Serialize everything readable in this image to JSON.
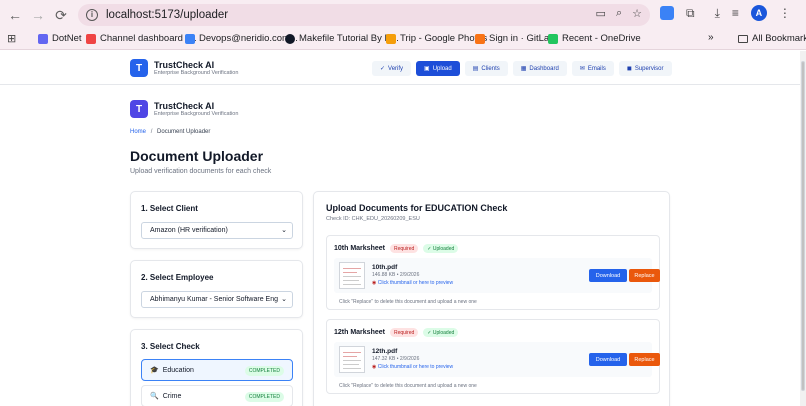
{
  "browser": {
    "url": "localhost:5173/uploader",
    "bookmarks": [
      {
        "label": "DotNet",
        "color": "#6366f1"
      },
      {
        "label": "Channel dashboard -...",
        "color": "#ef4444"
      },
      {
        "label": "Devops@neridio.com...",
        "color": "#3b82f6"
      },
      {
        "label": "Makefile Tutorial By E...",
        "color": "#111827"
      },
      {
        "label": "Trip - Google Photos",
        "color": "#f59e0b"
      },
      {
        "label": "Sign in · GitLab",
        "color": "#f97316"
      },
      {
        "label": "Recent - OneDrive",
        "color": "#22c55e"
      }
    ],
    "all_bookmarks": "All Bookmarks",
    "profile_initial": "A"
  },
  "nav": {
    "brand_title": "TrustCheck AI",
    "brand_sub": "Enterprise Background Verification",
    "logo_letter": "T",
    "tabs": [
      {
        "label": "Verify",
        "icon": "✓",
        "active": false
      },
      {
        "label": "Upload",
        "icon": "▣",
        "active": true
      },
      {
        "label": "Clients",
        "icon": "▤",
        "active": false
      },
      {
        "label": "Dashboard",
        "icon": "▦",
        "active": false
      },
      {
        "label": "Emails",
        "icon": "✉",
        "active": false
      },
      {
        "label": "Supervisor",
        "icon": "◼",
        "active": false
      }
    ]
  },
  "header": {
    "brand_title": "TrustCheck AI",
    "brand_sub": "Enterprise Background Verification",
    "logo_letter": "T",
    "breadcrumb_home": "Home",
    "breadcrumb_sep": "/",
    "breadcrumb_current": "Document Uploader",
    "title": "Document Uploader",
    "subtitle": "Upload verification documents for each check"
  },
  "left": {
    "client": {
      "heading": "1. Select Client",
      "value": "Amazon (HR verification)"
    },
    "employee": {
      "heading": "2. Select Employee",
      "value": "Abhimanyu Kumar - Senior Software Eng"
    },
    "check": {
      "heading": "3. Select Check",
      "items": [
        {
          "label": "Education",
          "icon": "🎓",
          "status": "COMPLETED"
        },
        {
          "label": "Crime",
          "icon": "🔍",
          "status": "COMPLETED"
        }
      ]
    }
  },
  "right": {
    "title": "Upload Documents for EDUCATION Check",
    "check_id": "Check ID: CHK_EDU_20260209_ESU",
    "docs": [
      {
        "title": "10th Marksheet",
        "required": "Required",
        "uploaded": "✓ Uploaded",
        "file": "10th.pdf",
        "meta": "146.88 KB • 2/9/2026",
        "preview": "Click thumbnail or here to preview",
        "download": "Download",
        "replace": "Replace",
        "hint": "Click \"Replace\" to delete this document and upload a new one"
      },
      {
        "title": "12th Marksheet",
        "required": "Required",
        "uploaded": "✓ Uploaded",
        "file": "12th.pdf",
        "meta": "147.32 KB • 2/9/2026",
        "preview": "Click thumbnail or here to preview",
        "download": "Download",
        "replace": "Replace",
        "hint": "Click \"Replace\" to delete this document and upload a new one"
      }
    ]
  }
}
